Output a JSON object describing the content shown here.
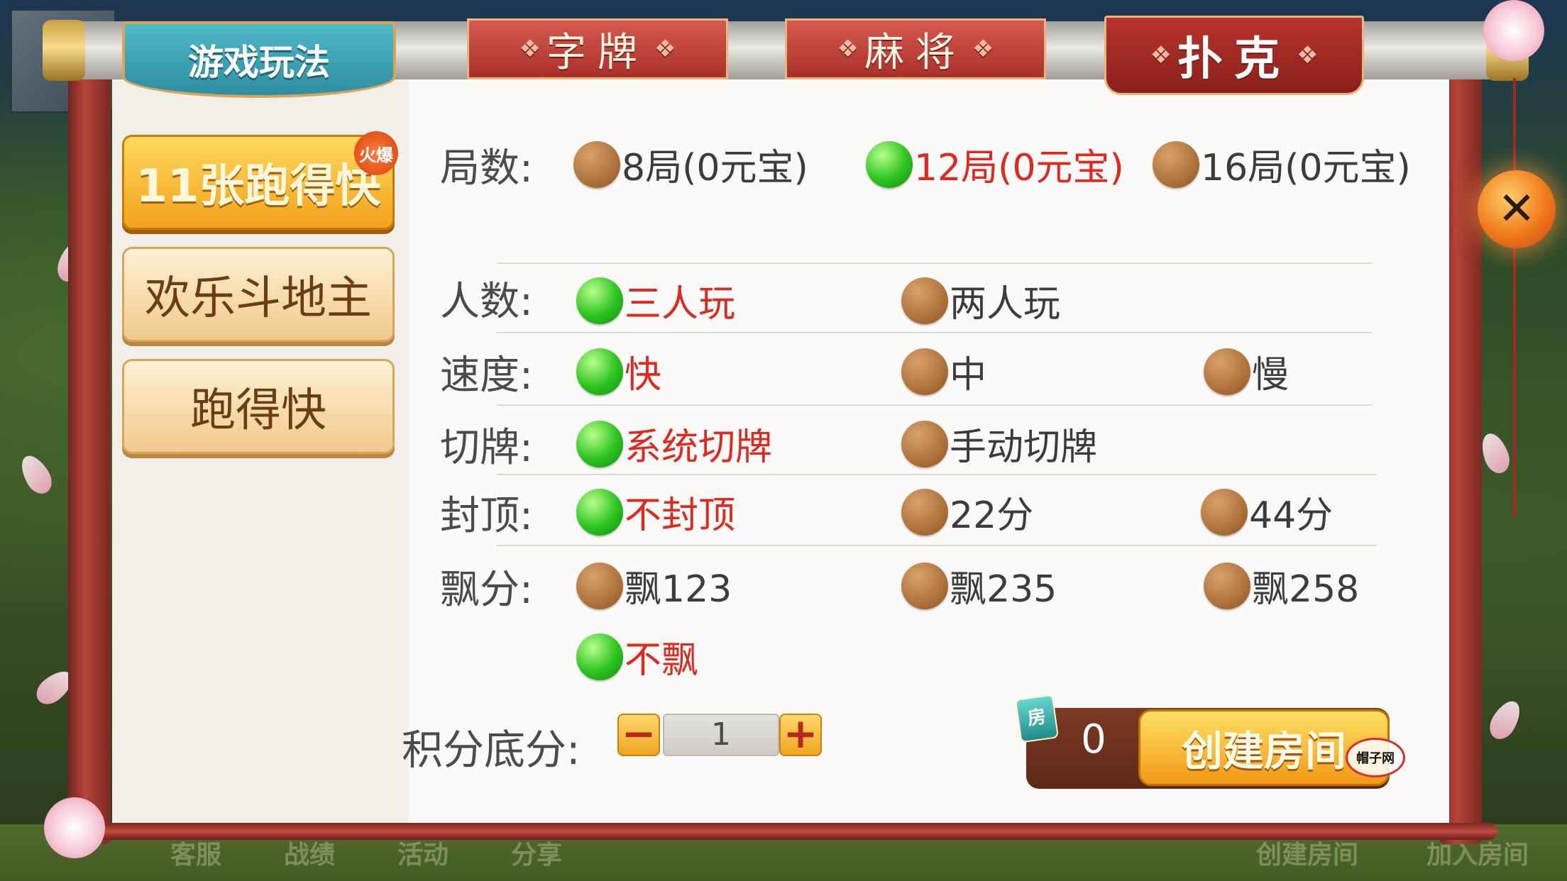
{
  "tabs": {
    "rules_label": "游戏玩法",
    "card_label": "字牌",
    "mahjong_label": "麻将",
    "poker_label": "扑克",
    "selected": "扑克"
  },
  "games": [
    {
      "label": "11张跑得快",
      "badge": "火爆",
      "active": true
    },
    {
      "label": "欢乐斗地主",
      "active": false
    },
    {
      "label": "跑得快",
      "active": false
    }
  ],
  "options": {
    "rounds": {
      "label": "局数:",
      "choices": [
        {
          "text": "8局(0元宝)",
          "selected": false
        },
        {
          "text": "12局(0元宝)",
          "selected": true
        },
        {
          "text": "16局(0元宝)",
          "selected": false
        }
      ]
    },
    "players": {
      "label": "人数:",
      "choices": [
        {
          "text": "三人玩",
          "selected": true
        },
        {
          "text": "两人玩",
          "selected": false
        }
      ]
    },
    "speed": {
      "label": "速度:",
      "choices": [
        {
          "text": "快",
          "selected": true
        },
        {
          "text": "中",
          "selected": false
        },
        {
          "text": "慢",
          "selected": false
        }
      ]
    },
    "cut": {
      "label": "切牌:",
      "choices": [
        {
          "text": "系统切牌",
          "selected": true
        },
        {
          "text": "手动切牌",
          "selected": false
        }
      ]
    },
    "cap": {
      "label": "封顶:",
      "choices": [
        {
          "text": "不封顶",
          "selected": true
        },
        {
          "text": "22分",
          "selected": false
        },
        {
          "text": "44分",
          "selected": false
        }
      ]
    },
    "float": {
      "label": "飘分:",
      "choices": [
        {
          "text": "飘123",
          "selected": false
        },
        {
          "text": "飘235",
          "selected": false
        },
        {
          "text": "飘258",
          "selected": false
        },
        {
          "text": "不飘",
          "selected": true
        }
      ]
    }
  },
  "score": {
    "label": "积分底分:",
    "minus": "−",
    "value": "1",
    "plus": "+"
  },
  "room": {
    "icon_label": "房",
    "count": "0",
    "create_label": "创建房间"
  },
  "close_label": "✕",
  "watermark": "帽子网",
  "background": {
    "bottom_items": [
      "客服",
      "战绩",
      "活动",
      "分享",
      "创建房间",
      "加入房间"
    ]
  },
  "colors": {
    "selected_text": "#e0281f",
    "radio_on": "#2bc320",
    "radio_off": "#a86a34",
    "tab_red": "#b8342d",
    "tab_teal": "#2d8ea2"
  }
}
